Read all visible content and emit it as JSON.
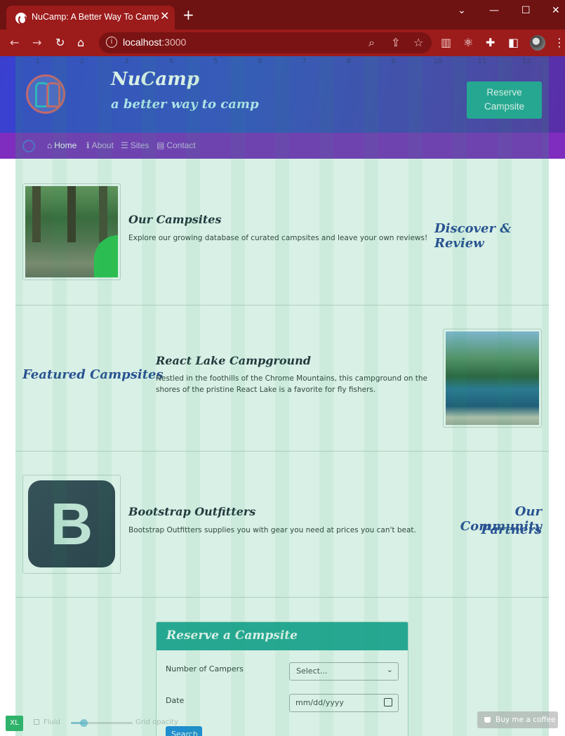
{
  "browser": {
    "tab_title": "NuCamp: A Better Way To Camp",
    "tab_close": "✕",
    "new_tab": "+",
    "url_host": "localhost",
    "url_port": ":3000",
    "window_controls": {
      "minimize": "—",
      "maximize": "☐",
      "close": "✕",
      "dropdown": "⌄"
    }
  },
  "header": {
    "brand": "NuCamp",
    "tagline": "a better way to camp",
    "reserve_button_line1": "Reserve",
    "reserve_button_line2": "Campsite"
  },
  "nav": {
    "items": [
      {
        "label": "Home",
        "icon": "home-icon",
        "active": true
      },
      {
        "label": "About",
        "icon": "info-icon",
        "active": false
      },
      {
        "label": "Sites",
        "icon": "list-icon",
        "active": false
      },
      {
        "label": "Contact",
        "icon": "address-card-icon",
        "active": false
      }
    ]
  },
  "sections": [
    {
      "title": "Our Campsites",
      "text": "Explore our growing database of curated campsites and leave your own reviews!",
      "side_heading": "Discover & Review"
    },
    {
      "title": "React Lake Campground",
      "text_line1": "Nestled in the foothills of the Chrome Mountains, this campground on the",
      "text_line2": "shores of the pristine React Lake is a favorite for fly fishers.",
      "side_heading": "Featured Campsites"
    },
    {
      "title": "Bootstrap Outfitters",
      "text": "Bootstrap Outfitters supplies you with gear you need at prices you can't beat.",
      "side_heading_line1": "Our Community",
      "side_heading_line2": "Partners",
      "logo_letter": "B"
    }
  ],
  "reserve_form": {
    "title": "Reserve a Campsite",
    "campers_label": "Number of Campers",
    "campers_value": "Select...",
    "date_label": "Date",
    "date_value": "mm/dd/yyyy",
    "search_label": "Search"
  },
  "grid_overlay": {
    "columns": [
      "1",
      "2",
      "3",
      "4",
      "5",
      "6",
      "7",
      "8",
      "9",
      "10",
      "11",
      "12"
    ],
    "breakpoint": "XL",
    "fluid_label": "Fluid",
    "opacity_label": "Grid opacity",
    "opacity_value": 0.2
  },
  "coffee_button": "Buy me a coffee",
  "colors": {
    "browser_frame": "#9c1b1b",
    "header_gradient_start": "#3a3fd0",
    "nav_bg": "#7e2dbf",
    "accent_teal": "#26a69a",
    "heading_blue": "#2a3f99",
    "grid_green": "#26ae6e"
  }
}
